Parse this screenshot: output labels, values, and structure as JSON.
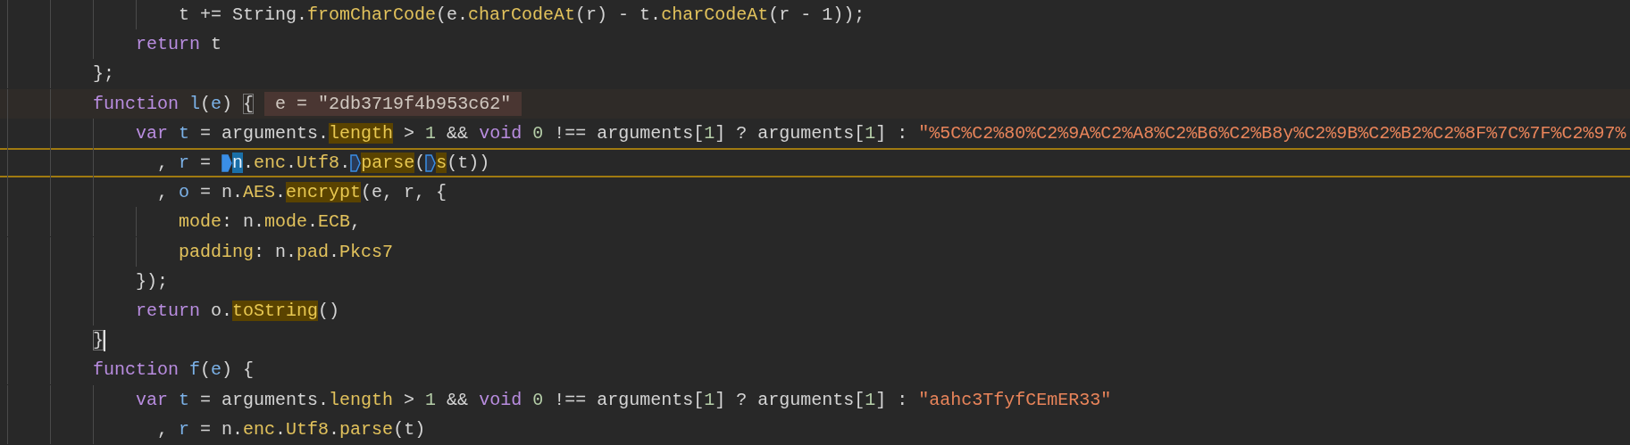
{
  "editor": {
    "lines": [
      {
        "children": [
          {
            "children": [
              {
                "kind": "plain",
                "continuation": false,
                "tokens": [
                  {
                    "kind": "plain",
                    "text": "t += String."
                  },
                  {
                    "kind": "prop",
                    "text": "fromCharCode"
                  },
                  {
                    "kind": "plain",
                    "text": "(e."
                  },
                  {
                    "kind": "prop",
                    "text": "charCodeAt"
                  },
                  {
                    "kind": "plain",
                    "text": "(r) - t."
                  },
                  {
                    "kind": "prop",
                    "text": "charCodeAt"
                  },
                  {
                    "kind": "plain",
                    "text": "(r - 1));"
                  }
                ]
              }
            ]
          },
          {
            "kind": "plain",
            "continuation": false,
            "tokens": [
              {
                "kind": "kw",
                "text": "return"
              },
              {
                "kind": "plain",
                "text": " t"
              }
            ]
          }
        ]
      },
      {
        "kind": "plain",
        "continuation": false,
        "tokens": [
          {
            "kind": "plain",
            "text": "};"
          }
        ]
      },
      {
        "kind": "hover",
        "continuation": false,
        "tokens": [
          {
            "kind": "kw",
            "text": "function"
          },
          {
            "kind": "id",
            "text": " l"
          },
          {
            "kind": "plain",
            "text": "("
          },
          {
            "kind": "id",
            "text": "e"
          },
          {
            "kind": "plain",
            "text": ") "
          },
          {
            "kind": "bracket",
            "text": "{"
          },
          {
            "kind": "inline-value",
            "text": "e = \"2db3719f4b953c62\""
          }
        ],
        "children": [
          {
            "kind": "plain",
            "continuation": false,
            "tokens": [
              {
                "kind": "kw",
                "text": "var"
              },
              {
                "kind": "id",
                "text": " t"
              },
              {
                "kind": "plain",
                "text": " = arguments."
              },
              {
                "kind": "match",
                "text": "length"
              },
              {
                "kind": "plain",
                "text": " > "
              },
              {
                "kind": "num",
                "text": "1"
              },
              {
                "kind": "plain",
                "text": " && "
              },
              {
                "kind": "kw",
                "text": "void"
              },
              {
                "kind": "num",
                "text": " 0"
              },
              {
                "kind": "plain",
                "text": " !== arguments["
              },
              {
                "kind": "num",
                "text": "1"
              },
              {
                "kind": "plain",
                "text": "] ? arguments["
              },
              {
                "kind": "num",
                "text": "1"
              },
              {
                "kind": "plain",
                "text": "] : "
              },
              {
                "kind": "str",
                "text": "\"%5C%C2%80%C2%9A%C2%A8%C2%B6%C2%B8y%C2%9B%C2%B2%C2%8F%7C%7F%C2%97%"
              }
            ]
          },
          {
            "kind": "paused",
            "continuation": true,
            "tokens": [
              {
                "kind": "plain",
                "text": ", "
              },
              {
                "kind": "id",
                "text": "r"
              },
              {
                "kind": "plain",
                "text": " = "
              },
              {
                "kind": "marker",
                "current": true
              },
              {
                "kind": "exec",
                "text": "n"
              },
              {
                "kind": "plain",
                "text": "."
              },
              {
                "kind": "prop",
                "text": "enc"
              },
              {
                "kind": "plain",
                "text": "."
              },
              {
                "kind": "prop",
                "text": "Utf8"
              },
              {
                "kind": "plain",
                "text": "."
              },
              {
                "kind": "marker",
                "current": false
              },
              {
                "kind": "match",
                "text": "parse"
              },
              {
                "kind": "plain",
                "text": "("
              },
              {
                "kind": "marker",
                "current": false
              },
              {
                "kind": "match",
                "text": "s"
              },
              {
                "kind": "plain",
                "text": "(t))"
              }
            ]
          },
          {
            "kind": "plain",
            "continuation": true,
            "tokens": [
              {
                "kind": "plain",
                "text": ", "
              },
              {
                "kind": "id",
                "text": "o"
              },
              {
                "kind": "plain",
                "text": " = n."
              },
              {
                "kind": "prop",
                "text": "AES"
              },
              {
                "kind": "plain",
                "text": "."
              },
              {
                "kind": "match",
                "text": "encrypt"
              },
              {
                "kind": "plain",
                "text": "(e, r, {"
              }
            ],
            "children": [
              {
                "kind": "plain",
                "continuation": false,
                "tokens": [
                  {
                    "kind": "prop",
                    "text": "mode"
                  },
                  {
                    "kind": "plain",
                    "text": ": n."
                  },
                  {
                    "kind": "prop",
                    "text": "mode"
                  },
                  {
                    "kind": "plain",
                    "text": "."
                  },
                  {
                    "kind": "prop",
                    "text": "ECB"
                  },
                  {
                    "kind": "plain",
                    "text": ","
                  }
                ]
              },
              {
                "kind": "plain",
                "continuation": false,
                "tokens": [
                  {
                    "kind": "prop",
                    "text": "padding"
                  },
                  {
                    "kind": "plain",
                    "text": ": n."
                  },
                  {
                    "kind": "prop",
                    "text": "pad"
                  },
                  {
                    "kind": "plain",
                    "text": "."
                  },
                  {
                    "kind": "prop",
                    "text": "Pkcs7"
                  }
                ]
              }
            ]
          },
          {
            "kind": "plain",
            "continuation": false,
            "tokens": [
              {
                "kind": "plain",
                "text": "});"
              }
            ]
          },
          {
            "kind": "plain",
            "continuation": false,
            "tokens": [
              {
                "kind": "kw",
                "text": "return"
              },
              {
                "kind": "plain",
                "text": " o."
              },
              {
                "kind": "match",
                "text": "toString"
              },
              {
                "kind": "plain",
                "text": "()"
              }
            ]
          }
        ]
      },
      {
        "kind": "plain",
        "continuation": false,
        "tokens": [
          {
            "kind": "bracket",
            "text": "}"
          },
          {
            "kind": "caret"
          }
        ]
      },
      {
        "kind": "plain",
        "continuation": false,
        "tokens": [
          {
            "kind": "kw",
            "text": "function"
          },
          {
            "kind": "id",
            "text": " f"
          },
          {
            "kind": "plain",
            "text": "("
          },
          {
            "kind": "id",
            "text": "e"
          },
          {
            "kind": "plain",
            "text": ") {"
          }
        ],
        "children": [
          {
            "kind": "plain",
            "continuation": false,
            "tokens": [
              {
                "kind": "kw",
                "text": "var"
              },
              {
                "kind": "id",
                "text": " t"
              },
              {
                "kind": "plain",
                "text": " = arguments."
              },
              {
                "kind": "prop",
                "text": "length"
              },
              {
                "kind": "plain",
                "text": " > "
              },
              {
                "kind": "num",
                "text": "1"
              },
              {
                "kind": "plain",
                "text": " && "
              },
              {
                "kind": "kw",
                "text": "void"
              },
              {
                "kind": "num",
                "text": " 0"
              },
              {
                "kind": "plain",
                "text": " !== arguments["
              },
              {
                "kind": "num",
                "text": "1"
              },
              {
                "kind": "plain",
                "text": "] ? arguments["
              },
              {
                "kind": "num",
                "text": "1"
              },
              {
                "kind": "plain",
                "text": "] : "
              },
              {
                "kind": "str",
                "text": "\"aahc3TfyfCEmER33\""
              }
            ]
          },
          {
            "kind": "plain",
            "continuation": true,
            "tokens": [
              {
                "kind": "plain",
                "text": ", "
              },
              {
                "kind": "id",
                "text": "r"
              },
              {
                "kind": "plain",
                "text": " = n."
              },
              {
                "kind": "prop",
                "text": "enc"
              },
              {
                "kind": "plain",
                "text": "."
              },
              {
                "kind": "prop",
                "text": "Utf8"
              },
              {
                "kind": "plain",
                "text": "."
              },
              {
                "kind": "prop",
                "text": "parse"
              },
              {
                "kind": "plain",
                "text": "(t)"
              }
            ]
          }
        ]
      }
    ]
  }
}
